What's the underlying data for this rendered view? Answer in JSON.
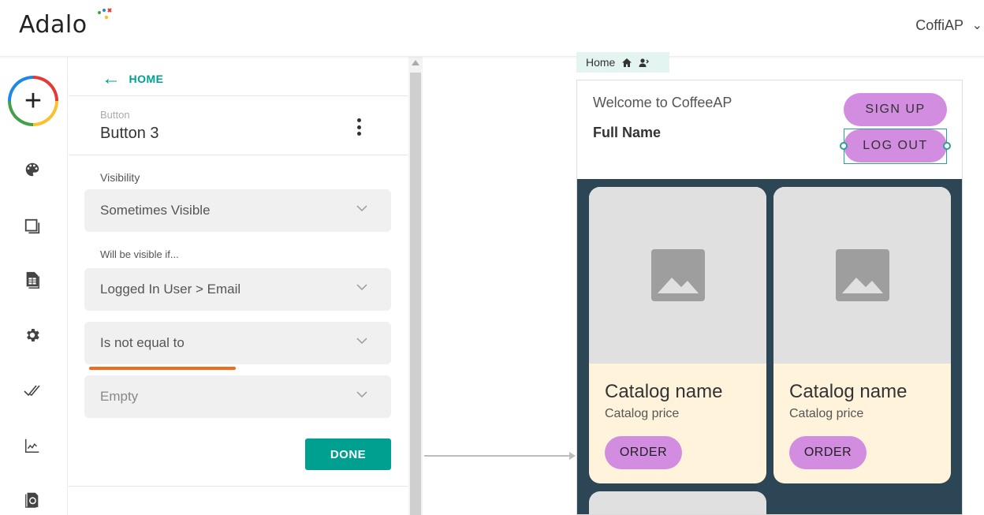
{
  "topbar": {
    "logo": "Adalo",
    "app_name": "CoffiAP",
    "app_chevron": "⌄"
  },
  "leftnav": {
    "add_label": "+",
    "icons": [
      "palette-icon",
      "screens-icon",
      "database-icon",
      "settings-icon",
      "publish-check-icon",
      "analytics-icon",
      "marketplace-icon"
    ]
  },
  "panel": {
    "back_label": "HOME",
    "component_type": "Button",
    "component_name": "Button 3",
    "visibility_label": "Visibility",
    "visibility_value": "Sometimes Visible",
    "condition_label": "Will be visible if...",
    "condition_field": "Logged In User > Email",
    "condition_operator": "Is not equal to",
    "condition_value": "Empty",
    "done_label": "DONE"
  },
  "canvas": {
    "screen_tab_label": "Home",
    "welcome_text": "Welcome to CoffeeAP",
    "full_name": "Full Name",
    "signup_label": "SIGN UP",
    "logout_label": "LOG OUT",
    "cards": [
      {
        "title": "Catalog name",
        "price": "Catalog price",
        "order_label": "ORDER"
      },
      {
        "title": "Catalog name",
        "price": "Catalog price",
        "order_label": "ORDER"
      }
    ]
  },
  "colors": {
    "accent": "#00a091",
    "highlight": "#f26a1b",
    "button_pink": "#d28ce0",
    "screen_bg": "#2d4656",
    "card_bg": "#fff3dc"
  }
}
